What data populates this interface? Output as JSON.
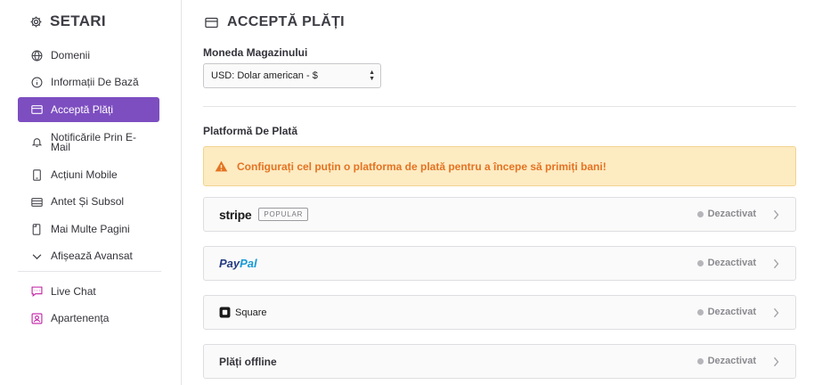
{
  "sidebar": {
    "title": "SETARI",
    "items": [
      {
        "label": "Domenii",
        "icon": "globe-icon"
      },
      {
        "label": "Informații De Bază",
        "icon": "info-icon"
      },
      {
        "label": "Acceptă Plăți",
        "icon": "card-icon",
        "active": true
      },
      {
        "label": "Notificările Prin E-Mail",
        "icon": "bell-icon"
      },
      {
        "label": "Acțiuni Mobile",
        "icon": "mobile-icon"
      },
      {
        "label": "Antet Și Subsol",
        "icon": "layout-icon"
      },
      {
        "label": "Mai Multe Pagini",
        "icon": "pages-icon"
      },
      {
        "label": "Afișează Avansat",
        "icon": "chevron-down-icon"
      }
    ],
    "extra": [
      {
        "label": "Live Chat",
        "icon": "chat-icon"
      },
      {
        "label": "Apartenența",
        "icon": "user-badge-icon"
      }
    ]
  },
  "main": {
    "title": "ACCEPTĂ PLĂȚI",
    "currency_label": "Moneda Magazinului",
    "currency_value": "USD: Dolar american - $",
    "platform_label": "Platformă De Plată",
    "warning": "Configurați cel puțin o platforma de plată pentru a începe să primiți bani!",
    "providers": [
      {
        "name": "stripe",
        "badge": "POPULAR",
        "status": "Dezactivat"
      },
      {
        "name_part1": "Pay",
        "name_part2": "Pal",
        "status": "Dezactivat"
      },
      {
        "name": "Square",
        "status": "Dezactivat"
      },
      {
        "name": "Plăți offline",
        "status": "Dezactivat"
      }
    ]
  },
  "colors": {
    "accent": "#7d4ec0",
    "warning_bg": "#fdebc2",
    "warning_text": "#e47322",
    "live_chat_icon": "#c21ca4"
  }
}
